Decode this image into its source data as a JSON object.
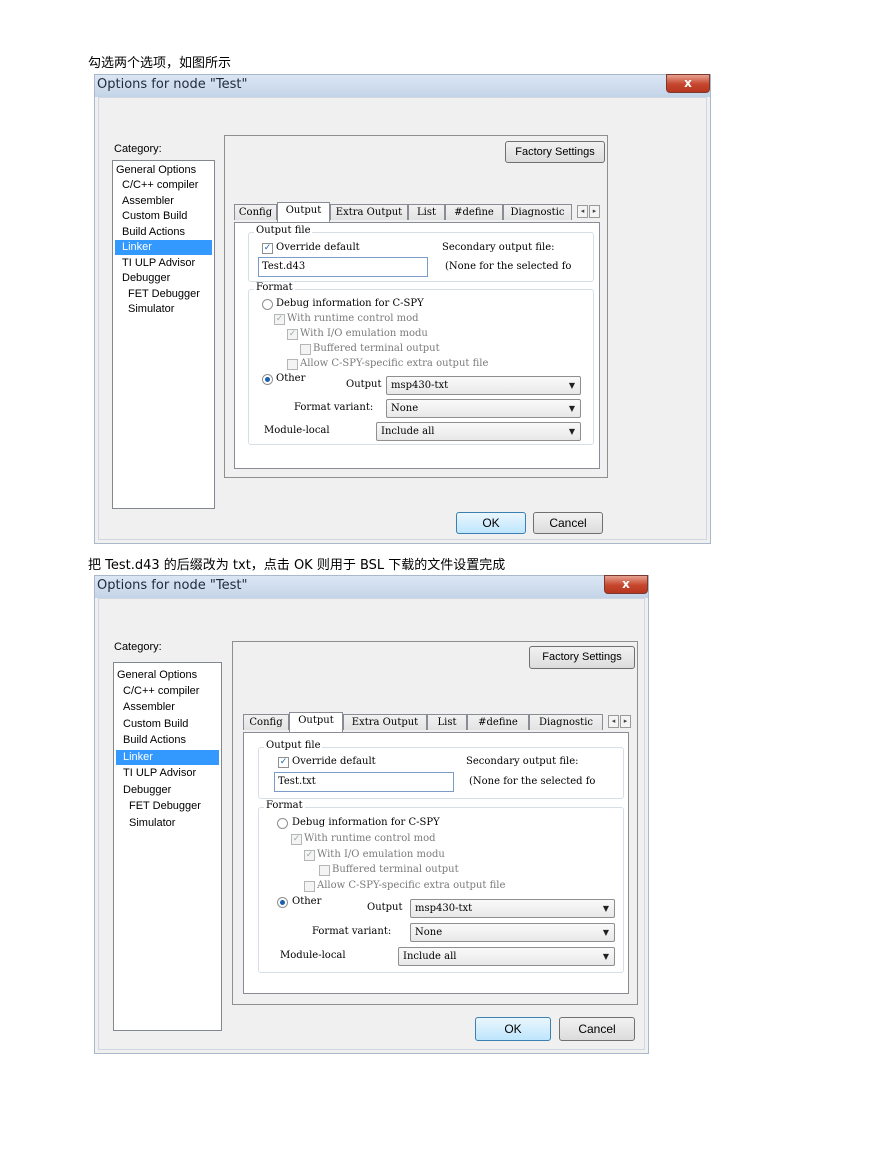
{
  "captions": {
    "first": "勾选两个选项，如图所示",
    "second": "把 Test.d43 的后缀改为 txt，点击 OK 则用于 BSL 下载的文件设置完成"
  },
  "dialog": {
    "title": "Options for node \"Test\"",
    "close_glyph": "x",
    "category_label": "Category:",
    "categories": [
      "General Options",
      "C/C++ compiler",
      "Assembler",
      "Custom Build",
      "Build Actions",
      "Linker",
      "TI ULP Advisor",
      "Debugger",
      "FET Debugger",
      "Simulator"
    ],
    "selected_category": "Linker",
    "factory_settings": "Factory Settings",
    "tabs": [
      "Config",
      "Output",
      "Extra Output",
      "List",
      "#define",
      "Diagnostic"
    ],
    "active_tab": "Output",
    "tab_scroll_left": "◂",
    "tab_scroll_right": "▸",
    "output_file_group": "Output file",
    "override_default": "Override default",
    "secondary_output": "Secondary output file:",
    "secondary_note": "(None for the selected fo",
    "format_group": "Format",
    "debug_info": "Debug information for C-SPY",
    "with_runtime": "With runtime control mod",
    "with_io": "With I/O emulation modu",
    "buffered": "Buffered terminal output",
    "allow_cspy": "Allow C-SPY-specific extra output file",
    "other": "Other",
    "output_label": "Output",
    "output_value": "msp430-txt",
    "format_variant_label": "Format variant:",
    "format_variant_value": "None",
    "module_local_label": "Module-local",
    "module_local_value": "Include all",
    "ok": "OK",
    "cancel": "Cancel",
    "check_glyph": "✓",
    "dropdown_glyph": "▼"
  },
  "screens": [
    {
      "filename": "Test.d43"
    },
    {
      "filename": "Test.txt"
    }
  ],
  "colors": {
    "selection": "#3399ff",
    "title_bar": "#c4d4e8",
    "close_button": "#c6452d"
  }
}
